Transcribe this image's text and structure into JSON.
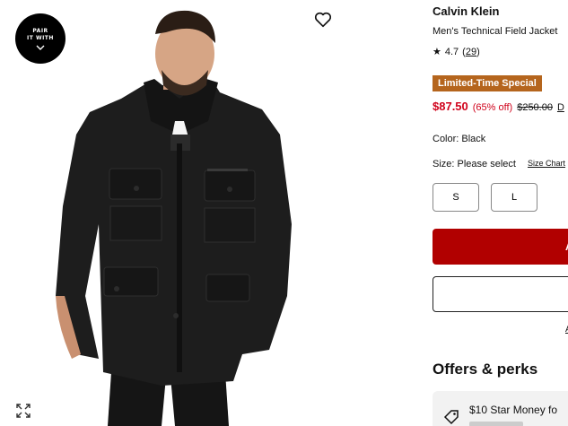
{
  "gallery": {
    "pair_badge": {
      "line1": "PAIR",
      "line2": "IT WITH"
    },
    "icons": [
      "heart-icon",
      "expand-icon",
      "chevron-down-icon"
    ]
  },
  "product": {
    "brand": "Calvin Klein",
    "name": "Men's Technical Field Jacket",
    "rating": {
      "score": "4.7",
      "count": "29"
    },
    "promo_badge": "Limited-Time Special",
    "promo_color": "#b5651d",
    "price": {
      "sale": "$87.50",
      "percent_off": "(65% off)",
      "original": "$250.00",
      "more": "D"
    },
    "sale_color": "#d0021b",
    "color": {
      "label": "Color:",
      "value": "Black"
    },
    "size": {
      "label": "Size:",
      "value": "Please select",
      "chart_link": "Size Chart"
    },
    "sizes": [
      "S",
      "L"
    ]
  },
  "actions": {
    "add_to_bag_label": "A",
    "add_to_bag_color": "#b10000",
    "side_link": "A"
  },
  "offers": {
    "title": "Offers & perks",
    "first_offer": "$10 Star Money fo"
  }
}
